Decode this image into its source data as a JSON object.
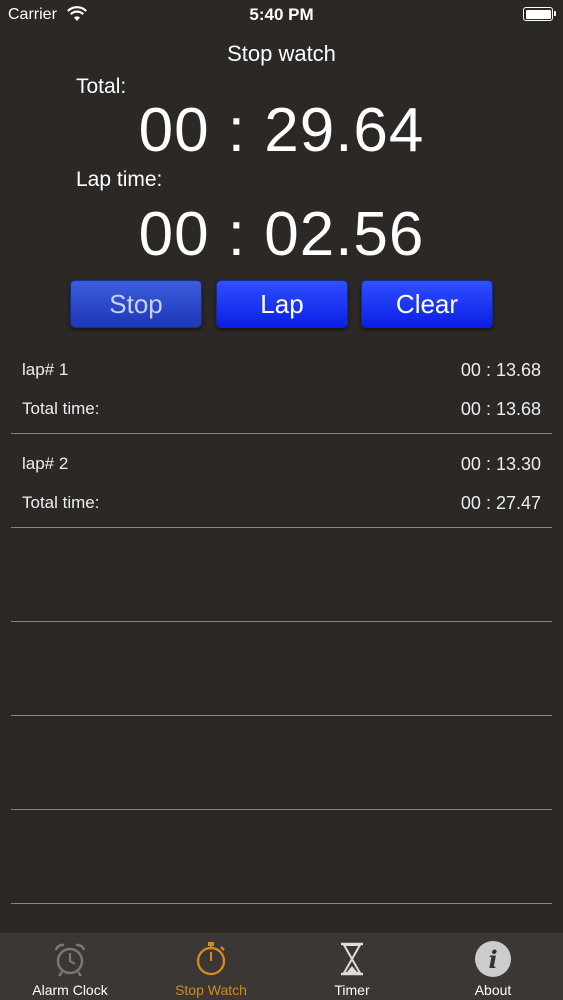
{
  "status": {
    "carrier": "Carrier",
    "time": "5:40 PM"
  },
  "title": "Stop watch",
  "total": {
    "label": "Total:",
    "value": "00 : 29.64"
  },
  "lap": {
    "label": "Lap time:",
    "value": "00 : 02.56"
  },
  "buttons": {
    "stop": "Stop",
    "lap": "Lap",
    "clear": "Clear"
  },
  "laps": [
    {
      "name": "lap# 1",
      "lap_time": "00 : 13.68",
      "total_label": "Total time:",
      "total_time": "00 : 13.68"
    },
    {
      "name": "lap# 2",
      "lap_time": "00 : 13.30",
      "total_label": "Total time:",
      "total_time": "00 : 27.47"
    }
  ],
  "tabs": [
    {
      "label": "Alarm Clock",
      "icon": "alarm-clock-icon"
    },
    {
      "label": "Stop Watch",
      "icon": "stopwatch-icon",
      "active": true
    },
    {
      "label": "Timer",
      "icon": "hourglass-icon"
    },
    {
      "label": "About",
      "icon": "info-icon"
    }
  ],
  "colors": {
    "background": "#2b2825",
    "active_tab": "#d68a1c",
    "button_blue": "#0a1ee6"
  }
}
